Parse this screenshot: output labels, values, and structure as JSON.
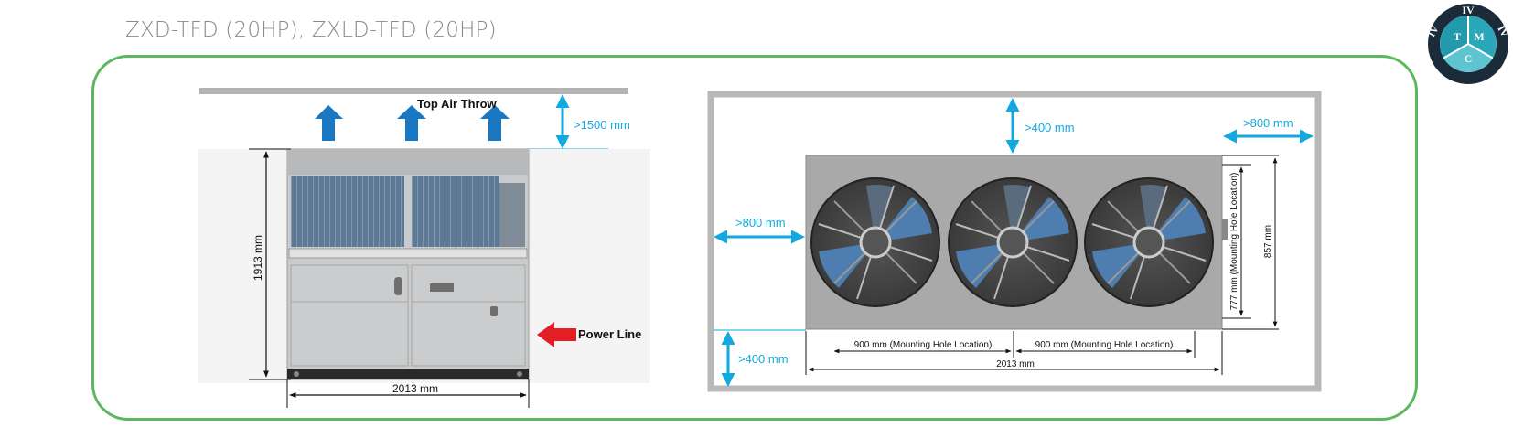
{
  "page": {
    "title": "ZXD-TFD (20HP), ZXLD-TFD (20HP)"
  },
  "logo": {
    "top_text": "IV",
    "left_text": "IV",
    "right_text": "IV",
    "letters": [
      "T",
      "M",
      "C"
    ]
  },
  "left_view": {
    "top_air_label": "Top Air Throw",
    "top_clearance": ">1500 mm",
    "height_label": "1913 mm",
    "width_label": "2013 mm",
    "power_label": "Power Line"
  },
  "right_view": {
    "top_clearance": ">400 mm",
    "right_clearance": ">800 mm",
    "left_clearance": ">800 mm",
    "bottom_clearance": ">400 mm",
    "hole_spacing_1": "900 mm (Mounting Hole Location)",
    "hole_spacing_2": "900 mm (Mounting Hole Location)",
    "total_width": "2013 mm",
    "hole_depth": "777 mm (Mounting Hole Location)",
    "depth": "857 mm"
  },
  "colors": {
    "frame_green": "#5cb85c",
    "arrow_blue": "#1a78c2",
    "dim_cyan": "#12a9e0",
    "power_red": "#e31e24",
    "title_gray": "#8a8a8a",
    "logo_teal": "#2aa7b8",
    "logo_dark": "#1c2b3a"
  }
}
